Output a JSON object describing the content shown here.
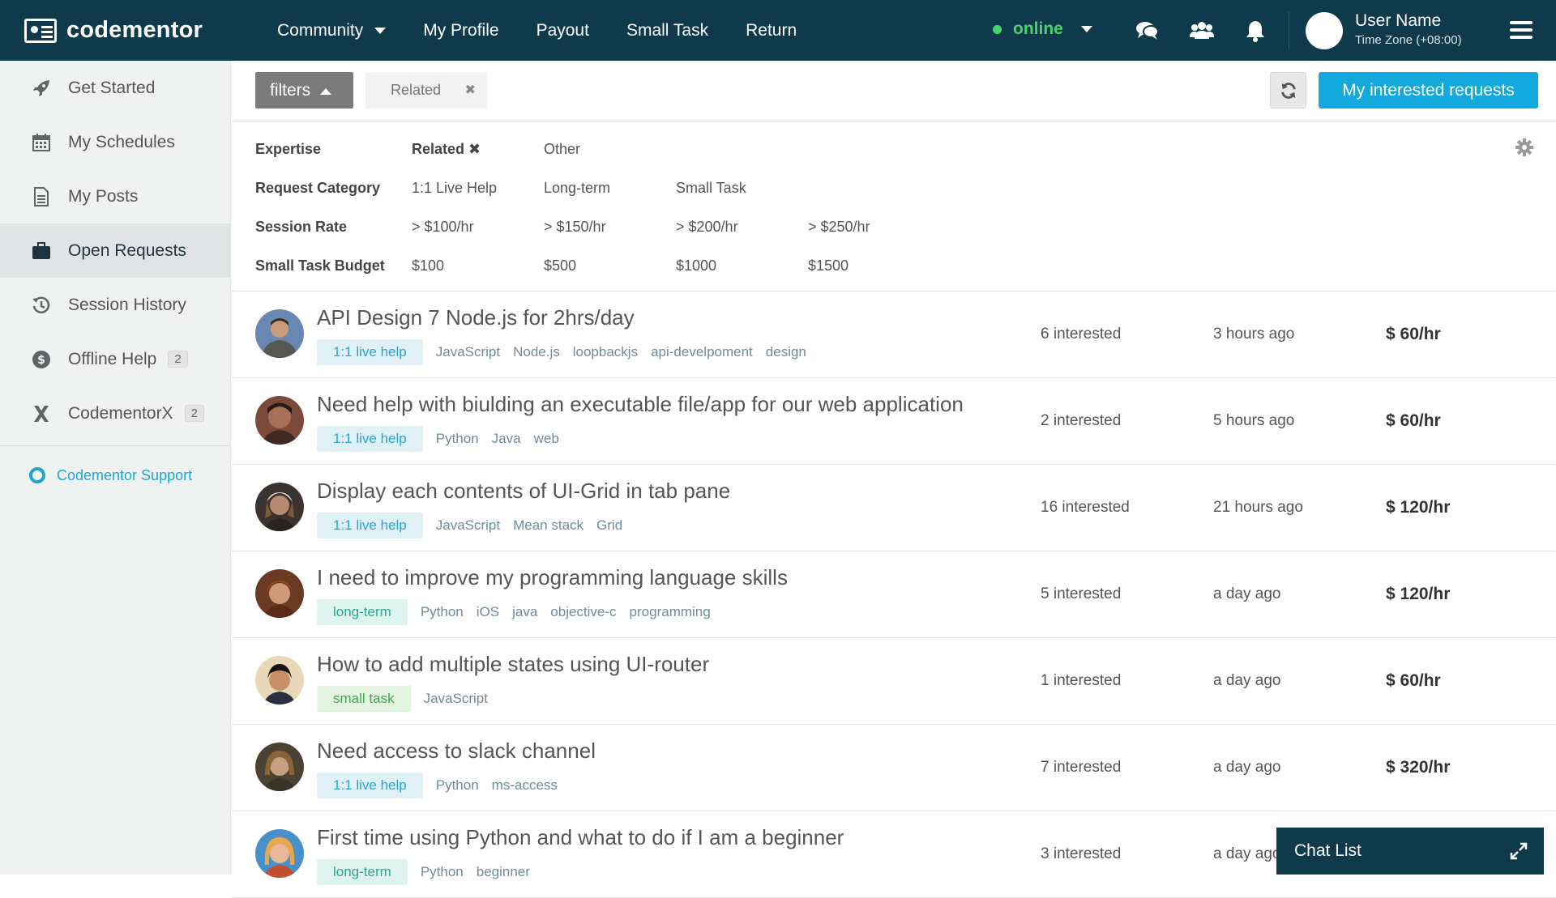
{
  "brand": {
    "name": "codementor"
  },
  "nav": {
    "links": [
      "Community",
      "My Profile",
      "Payout",
      "Small Task",
      "Return"
    ],
    "status": "online",
    "user_name": "User Name",
    "timezone": "Time Zone (+08:00)"
  },
  "sidebar": {
    "items": [
      {
        "label": "Get Started",
        "icon": "rocket-icon"
      },
      {
        "label": "My Schedules",
        "icon": "calendar-icon"
      },
      {
        "label": "My Posts",
        "icon": "document-icon"
      },
      {
        "label": "Open Requests",
        "icon": "briefcase-icon"
      },
      {
        "label": "Session History",
        "icon": "history-icon"
      },
      {
        "label": "Offline Help",
        "icon": "dollar-icon",
        "badge": "2"
      },
      {
        "label": "CodementorX",
        "icon": "x-logo-icon",
        "badge": "2"
      }
    ],
    "support": "Codementor Support"
  },
  "filterbar": {
    "filters_label": "filters",
    "chip_label": "Related",
    "chip_close": "✖",
    "primary_button": "My interested requests"
  },
  "filterpanel": {
    "rows": [
      {
        "label": "Expertise",
        "options": [
          "Related ✖",
          "Other"
        ]
      },
      {
        "label": "Request Category",
        "options": [
          "1:1 Live Help",
          "Long-term",
          "Small Task"
        ]
      },
      {
        "label": "Session Rate",
        "options": [
          "> $100/hr",
          "> $150/hr",
          "> $200/hr",
          "> $250/hr"
        ]
      },
      {
        "label": "Small Task Budget",
        "options": [
          "$100",
          "$500",
          "$1000",
          "$1500"
        ]
      }
    ]
  },
  "requests": [
    {
      "title": "API Design 7 Node.js for 2hrs/day",
      "type": "1:1 live help",
      "tags": [
        "JavaScript",
        "Node.js",
        "loopbackjs",
        "api-develpoment",
        "design"
      ],
      "interested": "6 interested",
      "time": "3 hours ago",
      "rate": "$ 60/hr"
    },
    {
      "title": "Need help with biulding an executable file/app for our web application",
      "type": "1:1 live help",
      "tags": [
        "Python",
        "Java",
        "web"
      ],
      "interested": "2 interested",
      "time": "5 hours ago",
      "rate": "$ 60/hr"
    },
    {
      "title": "Display each contents of UI-Grid in tab pane",
      "type": "1:1 live help",
      "tags": [
        "JavaScript",
        "Mean stack",
        "Grid"
      ],
      "interested": "16 interested",
      "time": "21 hours ago",
      "rate": "$ 120/hr"
    },
    {
      "title": "I need to improve my programming language skills",
      "type": "long-term",
      "tags": [
        "Python",
        "iOS",
        "java",
        "objective-c",
        "programming"
      ],
      "interested": "5 interested",
      "time": "a day ago",
      "rate": "$ 120/hr"
    },
    {
      "title": "How to add multiple states using UI-router",
      "type": "small task",
      "tags": [
        "JavaScript"
      ],
      "interested": "1 interested",
      "time": "a day ago",
      "rate": "$ 60/hr"
    },
    {
      "title": "Need access to slack channel",
      "type": "1:1 live help",
      "tags": [
        "Python",
        "ms-access"
      ],
      "interested": "7 interested",
      "time": "a day ago",
      "rate": "$ 320/hr"
    },
    {
      "title": "First time using Python and what to do if I am a beginner",
      "type": "long-term",
      "tags": [
        "Python",
        "beginner"
      ],
      "interested": "3 interested",
      "time": "a day ago",
      "rate": ""
    }
  ],
  "chat": {
    "label": "Chat List"
  },
  "colors": {
    "nav_bg": "#0f3a4b",
    "accent": "#13a9dd",
    "online": "#46d36a"
  }
}
